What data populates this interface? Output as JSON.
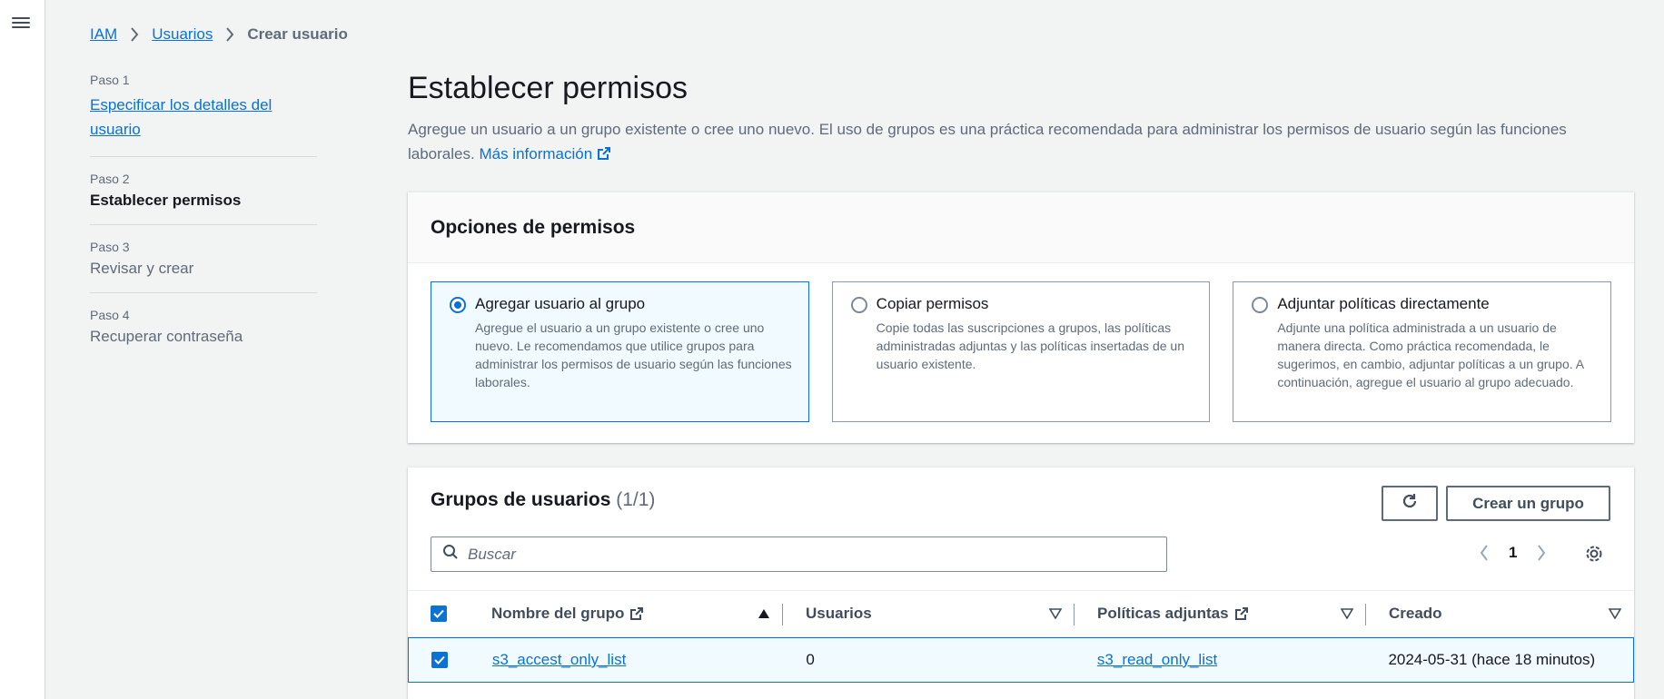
{
  "breadcrumb": {
    "items": [
      "IAM",
      "Usuarios"
    ],
    "current": "Crear usuario"
  },
  "steps": [
    {
      "num": "Paso 1",
      "label": "Especificar los detalles del usuario"
    },
    {
      "num": "Paso 2",
      "label": "Establecer permisos"
    },
    {
      "num": "Paso 3",
      "label": "Revisar y crear"
    },
    {
      "num": "Paso 4",
      "label": "Recuperar contraseña"
    }
  ],
  "page": {
    "title": "Establecer permisos",
    "description": "Agregue un usuario a un grupo existente o cree uno nuevo. El uso de grupos es una práctica recomendada para administrar los permisos de usuario según las funciones laborales.",
    "info_link": "Más información"
  },
  "permissions": {
    "title": "Opciones de permisos",
    "options": [
      {
        "title": "Agregar usuario al grupo",
        "desc": "Agregue el usuario a un grupo existente o cree uno nuevo. Le recomendamos que utilice grupos para administrar los permisos de usuario según las funciones laborales.",
        "selected": true
      },
      {
        "title": "Copiar permisos",
        "desc": "Copie todas las suscripciones a grupos, las políticas administradas adjuntas y las políticas insertadas de un usuario existente.",
        "selected": false
      },
      {
        "title": "Adjuntar políticas directamente",
        "desc": "Adjunte una política administrada a un usuario de manera directa. Como práctica recomendada, le sugerimos, en cambio, adjuntar políticas a un grupo. A continuación, agregue el usuario al grupo adecuado.",
        "selected": false
      }
    ]
  },
  "groups": {
    "title": "Grupos de usuarios",
    "count": "(1/1)",
    "create_label": "Crear un grupo",
    "search_placeholder": "Buscar",
    "page": "1",
    "columns": [
      "Nombre del grupo",
      "Usuarios",
      "Políticas adjuntas",
      "Creado"
    ],
    "rows": [
      {
        "name": "s3_accest_only_list",
        "users": "0",
        "policies": "s3_read_only_list",
        "created": "2024-05-31 (hace 18 minutos)"
      }
    ]
  },
  "colors": {
    "link": "#0972d3",
    "text": "#16191f",
    "muted": "#5f6b7a",
    "selected_bg": "#f1faff"
  }
}
